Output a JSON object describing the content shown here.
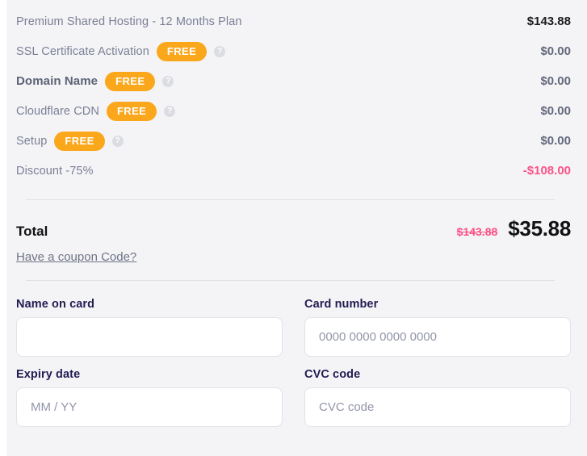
{
  "order_summary": {
    "items": [
      {
        "label": "Premium Shared Hosting - 12 Months Plan",
        "badge": null,
        "help": false,
        "price": "$143.88",
        "price_style": "dark",
        "bold": false
      },
      {
        "label": "SSL Certificate Activation",
        "badge": "FREE",
        "help": true,
        "price": "$0.00",
        "price_style": "normal",
        "bold": false
      },
      {
        "label": "Domain Name",
        "badge": "FREE",
        "help": true,
        "price": "$0.00",
        "price_style": "normal",
        "bold": true
      },
      {
        "label": "Cloudflare CDN",
        "badge": "FREE",
        "help": true,
        "price": "$0.00",
        "price_style": "normal",
        "bold": false
      },
      {
        "label": "Setup",
        "badge": "FREE",
        "help": true,
        "price": "$0.00",
        "price_style": "normal",
        "bold": false
      },
      {
        "label": "Discount -75%",
        "badge": null,
        "help": false,
        "price": "-$108.00",
        "price_style": "discount",
        "bold": false
      }
    ],
    "help_icon_glyph": "?"
  },
  "total": {
    "label": "Total",
    "original_price": "$143.88",
    "final_price": "$35.88"
  },
  "coupon": {
    "link_label": "Have a coupon Code?"
  },
  "card_form": {
    "name_on_card": {
      "label": "Name on card",
      "value": "",
      "placeholder": ""
    },
    "card_number": {
      "label": "Card number",
      "value": "",
      "placeholder": "0000 0000 0000 0000"
    },
    "expiry_date": {
      "label": "Expiry date",
      "value": "",
      "placeholder": "MM / YY"
    },
    "cvc_code": {
      "label": "CVC code",
      "value": "",
      "placeholder": "CVC code"
    }
  },
  "colors": {
    "panel_background": "#f4f4f6",
    "badge_orange": "#fba71c",
    "discount_pink": "#fb5386",
    "label_navy": "#221d52",
    "muted_gray": "#7a7f95",
    "divider": "#e0e0e4",
    "input_border": "#e3e3e8"
  }
}
